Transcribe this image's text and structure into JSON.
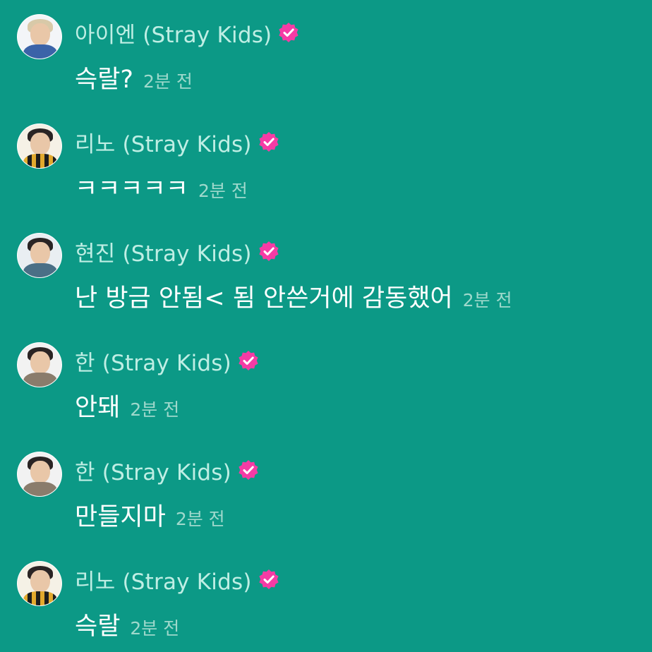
{
  "colors": {
    "background": "#0c9986",
    "name_text": "#bfeee4",
    "message_text": "#ffffff",
    "time_text": "#9fd9cc",
    "verified_badge": "#f53ba5"
  },
  "messages": [
    {
      "name": "아이엔 (Stray Kids)",
      "text": "슥랄?",
      "time": "2분 전",
      "verified": true,
      "avatar_icon": "avatar-photo"
    },
    {
      "name": "리노 (Stray Kids)",
      "text": "ㅋㅋㅋㅋㅋ",
      "time": "2분 전",
      "verified": true,
      "avatar_icon": "avatar-photo"
    },
    {
      "name": "현진 (Stray Kids)",
      "text": "난 방금 안됨< 됨 안쓴거에 감동했어",
      "time": "2분 전",
      "verified": true,
      "avatar_icon": "avatar-photo"
    },
    {
      "name": "한 (Stray Kids)",
      "text": "안돼",
      "time": "2분 전",
      "verified": true,
      "avatar_icon": "avatar-photo"
    },
    {
      "name": "한 (Stray Kids)",
      "text": "만들지마",
      "time": "2분 전",
      "verified": true,
      "avatar_icon": "avatar-photo"
    },
    {
      "name": "리노 (Stray Kids)",
      "text": "슥랄",
      "time": "2분 전",
      "verified": true,
      "avatar_icon": "avatar-photo"
    }
  ]
}
